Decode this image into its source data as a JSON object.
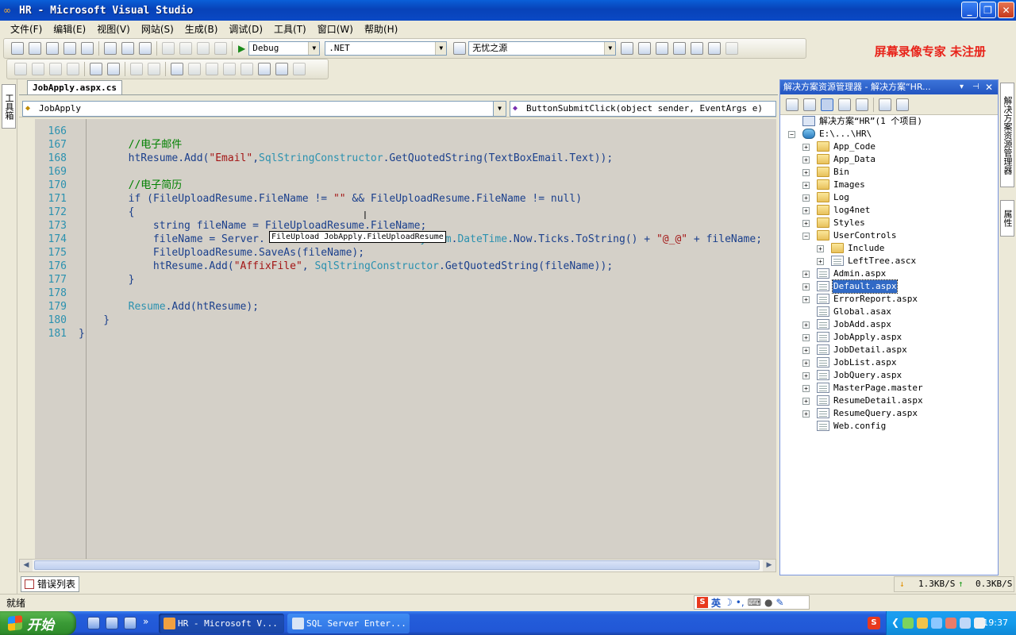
{
  "window": {
    "title": "HR - Microsoft Visual Studio"
  },
  "watermark": "屏幕录像专家  未注册",
  "menu": [
    "文件(F)",
    "编辑(E)",
    "视图(V)",
    "网站(S)",
    "生成(B)",
    "调试(D)",
    "工具(T)",
    "窗口(W)",
    "帮助(H)"
  ],
  "toolbar": {
    "config": "Debug",
    "platform": ".NET",
    "search": "无忧之源"
  },
  "toolbox_label": "工具箱",
  "document_tab": "JobApply.aspx.cs",
  "nav": {
    "class_combo": "JobApply",
    "member_combo": "ButtonSubmitClick(object sender, EventArgs e)"
  },
  "code": {
    "lines": [
      {
        "n": "166",
        "t": ""
      },
      {
        "n": "167",
        "t": "        //电子邮件"
      },
      {
        "n": "168",
        "t": "        htResume.Add(\"Email\",SqlStringConstructor.GetQuotedString(TextBoxEmail.Text));"
      },
      {
        "n": "169",
        "t": ""
      },
      {
        "n": "170",
        "t": "        //电子简历"
      },
      {
        "n": "171",
        "t": "        if (FileUploadResume.FileName != \"\" && FileUploadResume.FileName != null)"
      },
      {
        "n": "172",
        "t": "        {"
      },
      {
        "n": "173",
        "t": "            string fileName = FileUploadResume.FileName;"
      },
      {
        "n": "174",
        "t": "            fileName = Server.                      + System.DateTime.Now.Ticks.ToString() + \"@_@\" + fileName;"
      },
      {
        "n": "175",
        "t": "            FileUploadResume.SaveAs(fileName);"
      },
      {
        "n": "176",
        "t": "            htResume.Add(\"AffixFile\", SqlStringConstructor.GetQuotedString(fileName));"
      },
      {
        "n": "177",
        "t": "        }"
      },
      {
        "n": "178",
        "t": ""
      },
      {
        "n": "179",
        "t": "        Resume.Add(htResume);"
      },
      {
        "n": "180",
        "t": "    }"
      },
      {
        "n": "181",
        "t": "}"
      }
    ],
    "tooltip": "FileUpload JobApply.FileUploadResume"
  },
  "error_list_tab": "错误列表",
  "solution_explorer": {
    "title": "解决方案资源管理器 - 解决方案“HR...",
    "items": [
      {
        "label": "解决方案“HR”(1 个项目)",
        "icon": "solution",
        "expander": "",
        "selected": false
      },
      {
        "label": "E:\\...\\HR\\",
        "icon": "project",
        "expander": "−",
        "selected": false
      },
      {
        "label": "App_Code",
        "icon": "folder",
        "expander": "+",
        "selected": false
      },
      {
        "label": "App_Data",
        "icon": "folder",
        "expander": "+",
        "selected": false
      },
      {
        "label": "Bin",
        "icon": "folder",
        "expander": "+",
        "selected": false
      },
      {
        "label": "Images",
        "icon": "folder",
        "expander": "+",
        "selected": false
      },
      {
        "label": "Log",
        "icon": "folder",
        "expander": "+",
        "selected": false
      },
      {
        "label": "log4net",
        "icon": "folder",
        "expander": "+",
        "selected": false
      },
      {
        "label": "Styles",
        "icon": "folder",
        "expander": "+",
        "selected": false
      },
      {
        "label": "UserControls",
        "icon": "folder",
        "expander": "−",
        "selected": false
      },
      {
        "label": "Include",
        "icon": "folder",
        "expander": "+",
        "selected": false
      },
      {
        "label": "LeftTree.ascx",
        "icon": "page",
        "expander": "+",
        "selected": false
      },
      {
        "label": "Admin.aspx",
        "icon": "page",
        "expander": "+",
        "selected": false
      },
      {
        "label": "Default.aspx",
        "icon": "page",
        "expander": "+",
        "selected": true
      },
      {
        "label": "ErrorReport.aspx",
        "icon": "page",
        "expander": "+",
        "selected": false
      },
      {
        "label": "Global.asax",
        "icon": "page",
        "expander": "",
        "selected": false
      },
      {
        "label": "JobAdd.aspx",
        "icon": "page",
        "expander": "+",
        "selected": false
      },
      {
        "label": "JobApply.aspx",
        "icon": "page",
        "expander": "+",
        "selected": false
      },
      {
        "label": "JobDetail.aspx",
        "icon": "page",
        "expander": "+",
        "selected": false
      },
      {
        "label": "JobList.aspx",
        "icon": "page",
        "expander": "+",
        "selected": false
      },
      {
        "label": "JobQuery.aspx",
        "icon": "page",
        "expander": "+",
        "selected": false
      },
      {
        "label": "MasterPage.master",
        "icon": "page",
        "expander": "+",
        "selected": false
      },
      {
        "label": "ResumeDetail.aspx",
        "icon": "page",
        "expander": "+",
        "selected": false
      },
      {
        "label": "ResumeQuery.aspx",
        "icon": "page",
        "expander": "+",
        "selected": false
      },
      {
        "label": "Web.config",
        "icon": "page",
        "expander": "",
        "selected": false
      }
    ]
  },
  "right_tabs": [
    "解决方案资源管理器",
    "属性"
  ],
  "speed": {
    "down": "1.3KB/S",
    "up": "0.3KB/S"
  },
  "status": "就绪",
  "ime_label": "英",
  "taskbar": {
    "start": "开始",
    "tasks": [
      "HR - Microsoft V...",
      "SQL Server Enter..."
    ],
    "clock": "19:37"
  },
  "colors": {
    "title_blue": "#0a5fd8",
    "editor_bg": "#d4d0c8",
    "comment": "#008000",
    "string": "#a31515",
    "type": "#2b91af",
    "selected": "#316ac5"
  }
}
